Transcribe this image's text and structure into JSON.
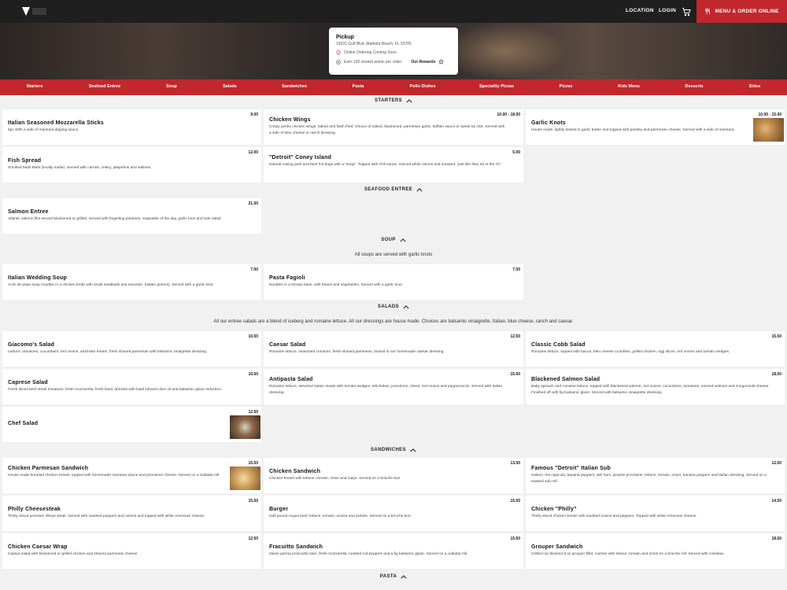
{
  "nav": {
    "location": "LOCATION",
    "login": "LOGIN",
    "order": "MENU & ORDER ONLINE"
  },
  "pickup": {
    "title": "Pickup",
    "address": "15031 Gulf Blvd, Madeira Beach, FL 33705",
    "notice": "Online Ordering Coming Soon",
    "rewards_text": "Earn 100 reward points per order",
    "rewards_link": "Our Rewards"
  },
  "categories": [
    "Starters",
    "Seafood Entree",
    "Soup",
    "Salads",
    "Sandwiches",
    "Pasta",
    "Pollo Dishes",
    "Speciality Pizzas",
    "Pizzas",
    "Kids Menu",
    "Desserts",
    "Sides"
  ],
  "sections": {
    "starters": {
      "title": "STARTERS",
      "items": [
        {
          "name": "Italian Seasoned Mozzarella Sticks",
          "price": "9.00",
          "desc": "6pc With a side of marinara dipping sauce."
        },
        {
          "name": "Chicken Wings",
          "price": "10.00 - 18.00",
          "desc": "Crispy jumbo chicken wings, baked and flash fried. Choice of naked, blackened, parmesan garlic, buffalo sauce or sweet tai chili. Served with a side of bleu cheese or ranch dressing."
        },
        {
          "name": "Garlic Knots",
          "price": "10.00 - 15.00",
          "desc": "House made, lightly tossed in garlic butter and topped with parsley and parmesan cheese. Served with a side of marinara."
        },
        {
          "name": "Fish Spread",
          "price": "12.00",
          "desc": "Smoked Mahi Mahi (locally made). Served with carrots, celery, jalapeños and saltines."
        },
        {
          "name": "\"Detroit\" Coney Island",
          "price": "5.00",
          "desc": "Natural casing pork and beef hot dogs with a \"snap\". Topped with chili sauce, minced white onions and mustard. Just like they do in the \"D\"."
        }
      ]
    },
    "seafood": {
      "title": "SEAFOOD ENTREE",
      "items": [
        {
          "name": "Salmon Entree",
          "price": "21.50",
          "desc": "Atlantic salmon filet served blackened or grilled. Served with fingerling potatoes, vegetable of the day, garlic knot and side salad"
        }
      ]
    },
    "soup": {
      "title": "SOUP",
      "note": "All soups are served with garlic knots",
      "items": [
        {
          "name": "Italian Wedding Soup",
          "price": "7.00",
          "desc": "Acini de pepe soup noodles in a chicken broth with small meatballs and escarole. (Italian greens). Served with a garlic knot"
        },
        {
          "name": "Pasta Fagioli",
          "price": "7.00",
          "desc": "Noodles in a tomato base, with beans and vegetables. Served with a garlic knot"
        }
      ]
    },
    "salads": {
      "title": "SALADS",
      "note": "All our entree salads are a blend of iceberg and romaine lettuce. All our dressings are house made. Choices are balsamic vinaigrette, Italian, blue cheese, ranch and caesar.",
      "items": [
        {
          "name": "Giacomo's Salad",
          "price": "10.50",
          "desc": "Lettuce, tomatoes, cucumbers, red onions, artichoke hearts, fresh shaved parmesan with balsamic vinaigrette dressing."
        },
        {
          "name": "Caesar Salad",
          "price": "12.50",
          "desc": "Romaine lettuce, seasoned croutons, fresh shaved parmesan, tossed in our homemade caesar dressing."
        },
        {
          "name": "Classic Cobb Salad",
          "price": "15.50",
          "desc": "Romaine lettuce, topped with bacon, bleu cheese crumbles, grilled chicken, egg slices, red onions and tomato wedges."
        },
        {
          "name": "Caprese Salad",
          "price": "10.50",
          "desc": "Fresh sliced beef steak tomatoes, fresh mozzarella, fresh basil, drizzled with basil infused olive oil and balsamic glaze reduction."
        },
        {
          "name": "Antipasta Salad",
          "price": "15.50",
          "desc": "Romaine lettuce, assorted Italian meats with tomato wedges, artichokes, provolone, olives, red onions and pepperoncini. Served with Italian dressing."
        },
        {
          "name": "Blackened Salmon Salad",
          "price": "18.50",
          "desc": "Baby spinach and romaine lettuce, topped with blackened salmon, red onions, cucumbers, tomatoes, canned walnuts and Gorgonzola cheese. Finished off with fig balsamic glaze. Served with balsamic vinaigrette dressing."
        },
        {
          "name": "Chef Salad",
          "price": "12.50",
          "desc": ""
        }
      ]
    },
    "sandwiches": {
      "title": "SANDWICHES",
      "items": [
        {
          "name": "Chicken Parmesan Sandwich",
          "price": "15.50",
          "desc": "House made breaded chicken breast, topped with homemade marinara sauce and provolone cheese. Served on a ciabatta roll."
        },
        {
          "name": "Chicken Sandwich",
          "price": "13.50",
          "desc": "Chicken breast with lettuce, tomato, onion and mayo. Served on a brioche bun"
        },
        {
          "name": "Famous \"Detroit\" Italian Sub",
          "price": "12.50",
          "desc": "Salami, hot capicola, banana peppers, deli ham, picante provolone, lettuce, tomato, onion, banana peppers and Italian dressing. Served on a toasted sub roll."
        },
        {
          "name": "Philly Cheesesteak",
          "price": "15.50",
          "desc": "Thinly sliced premium ribeye steak, Served with sautéed peppers and onions and topped with white American cheese."
        },
        {
          "name": "Burger",
          "price": "15.50",
          "desc": "Half pound Angus beef, lettuce, tomato, onions and pickles. Served on a brioche bun."
        },
        {
          "name": "Chicken \"Philly\"",
          "price": "14.50",
          "desc": "Thinly sliced chicken breast with sautéed onions and peppers. Topped with white American cheese."
        },
        {
          "name": "Chicken Caesar Wrap",
          "price": "12.50",
          "desc": "Caesar salad with blackened or grilled chicken and shaved parmesan cheese"
        },
        {
          "name": "Fracuitto Sandwich",
          "price": "15.50",
          "desc": "Italian parma prosciutto ham, fresh mozzarella, roasted red peppers and a fig balsamic glaze. Served on a ciabatta roll."
        },
        {
          "name": "Grouper Sandwich",
          "price": "18.50",
          "desc": "Grilled nor blacked 8 oz grouper fillet, /comes with lettuce, tomato and onion on a brioche roll. Served with coleslaw."
        }
      ]
    },
    "pasta": {
      "title": "PASTA"
    }
  },
  "colors": {
    "brand_red": "#c1272d",
    "topbar": "#1f1f1f",
    "card_bg": "#ffffff",
    "page_bg": "#f1f1f1"
  }
}
